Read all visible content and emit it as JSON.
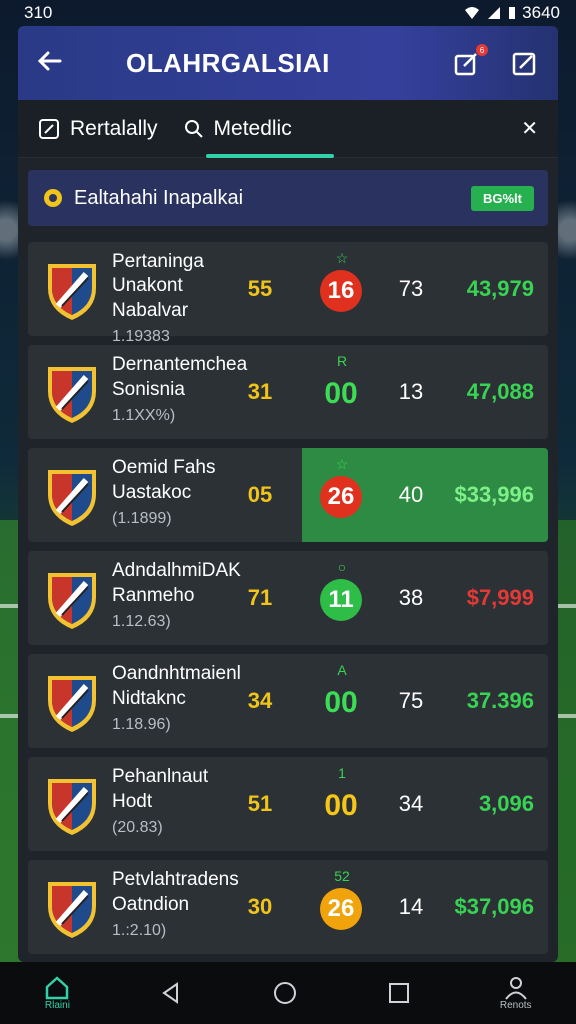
{
  "status": {
    "time": "310",
    "right_text": "3640"
  },
  "appbar": {
    "title": "OLAHRGALSIAI",
    "badge": "6"
  },
  "tabs": [
    {
      "label": "Rertalally",
      "icon": "edit-icon"
    },
    {
      "label": "Metedlic",
      "icon": "search-icon"
    }
  ],
  "header": {
    "title": "Ealtahahi Inapalkai",
    "pill": "BG%lt"
  },
  "rows": [
    {
      "line1": "Pertaninga Unakont",
      "line2": "Nabalvar",
      "line3": "1.19383",
      "score": "55",
      "mark": "☆",
      "ball": "16",
      "ball_style": "red",
      "pts": "73",
      "money": "43,979",
      "money_color": "#39d353",
      "highlight": false
    },
    {
      "line1": "Dernantemchea",
      "line2": "Sonisnia",
      "line3": "1.1XX%)",
      "score": "31",
      "mark": "R",
      "ball": "00",
      "ball_style": "plain-green",
      "pts": "13",
      "money": "47,088",
      "money_color": "#39d353",
      "highlight": false
    },
    {
      "line1": "Oemid Fahs",
      "line2": "Uastakoc",
      "line3": "(1.1899)",
      "score": "05",
      "mark": "☆",
      "ball": "26",
      "ball_style": "red",
      "pts": "40",
      "money": "$33,996",
      "money_color": "#7ef089",
      "highlight": true
    },
    {
      "line1": "AdndalhmiDAK",
      "line2": "Ranmeho",
      "line3": "1.12.63)",
      "score": "71",
      "mark": "○",
      "ball": "11",
      "ball_style": "green",
      "pts": "38",
      "money": "$7,999",
      "money_color": "#e53935",
      "highlight": false
    },
    {
      "line1": "Oandnhtmaienl",
      "line2": "Nidtaknc",
      "line3": "1.18.96)",
      "score": "34",
      "mark": "A",
      "ball": "00",
      "ball_style": "plain-green",
      "pts": "75",
      "money": "37.396",
      "money_color": "#39d353",
      "highlight": false
    },
    {
      "line1": "Pehanlnaut",
      "line2": "Hodt",
      "line3": "(20.83)",
      "score": "51",
      "mark": "1",
      "ball": "00",
      "ball_style": "plain-yellow",
      "pts": "34",
      "money": "3,096",
      "money_color": "#39d353",
      "highlight": false
    },
    {
      "line1": "Petvlahtradens",
      "line2": "Oatndion",
      "line3": "1.:2.10)",
      "score": "30",
      "mark": "52",
      "ball": "26",
      "ball_style": "orange",
      "pts": "14",
      "money": "$37,096",
      "money_color": "#39d353",
      "highlight": false
    }
  ],
  "nav": [
    {
      "label": "Rlaini",
      "icon": "home-icon"
    },
    {
      "label": "",
      "icon": "back-triangle-icon"
    },
    {
      "label": "",
      "icon": "home-circle-icon"
    },
    {
      "label": "",
      "icon": "recents-square-icon"
    },
    {
      "label": "Renots",
      "icon": "profile-icon"
    }
  ]
}
